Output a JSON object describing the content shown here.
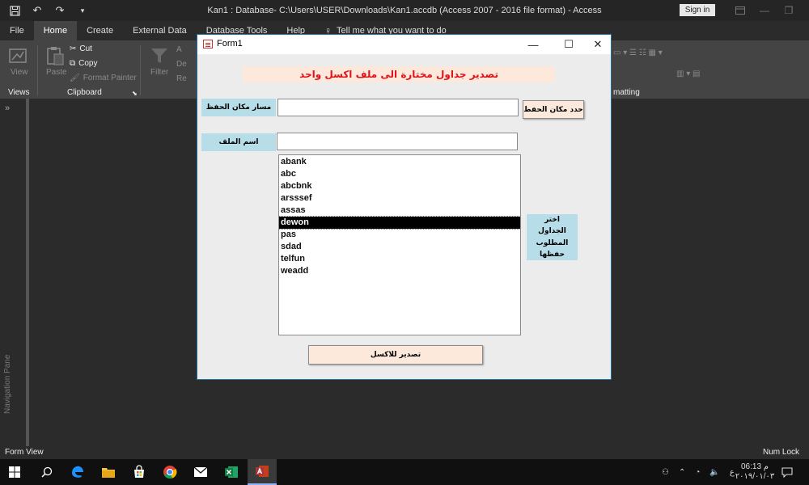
{
  "window": {
    "title": "Kan1 : Database- C:\\Users\\USER\\Downloads\\Kan1.accdb (Access 2007 - 2016 file format)  -  Access",
    "sign_in": "Sign in"
  },
  "ribbon": {
    "tabs": [
      "File",
      "Home",
      "Create",
      "External Data",
      "Database Tools",
      "Help"
    ],
    "tell_me": "Tell me what you want to do",
    "groups": {
      "views": {
        "label": "Views",
        "view": "View"
      },
      "clipboard": {
        "label": "Clipboard",
        "paste": "Paste",
        "cut": "Cut",
        "copy": "Copy",
        "format_painter": "Format Painter"
      },
      "filter": {
        "filter": "Filter",
        "partial1": "A",
        "partial2": "De",
        "partial3": "Re"
      },
      "formatting": {
        "label": "matting"
      }
    }
  },
  "navigation_pane": {
    "label": "Navigation Pane"
  },
  "form": {
    "title": "Form1",
    "heading": "تصدير جداول مختارة الى ملف اكسل واحد",
    "save_path_label": "مسار مكان الحفظ",
    "save_path_value": "",
    "choose_location_button": "حدد مكان الحفظ",
    "file_name_label": "اسم الملف",
    "file_name_value": "",
    "tables_label": "اختر الجداول المطلوب حفظها",
    "tables": [
      "abank",
      "abc",
      "abcbnk",
      "arsssef",
      "assas",
      "dewon",
      "pas",
      "sdad",
      "telfun",
      "weadd"
    ],
    "selected_table": "dewon",
    "export_button": "تصدير للاكسل"
  },
  "status": {
    "left": "Form View",
    "right": "Num Lock"
  },
  "taskbar": {
    "time": "06:13 م",
    "date": "٢٠١٩/٠١/٠٣",
    "lang": "ع"
  },
  "colors": {
    "heading_bg": "#fde9dc",
    "heading_text": "#e0121b",
    "label_bg": "#b7dde8",
    "button_bg": "#fde9dc",
    "form_bg": "#ececec"
  }
}
